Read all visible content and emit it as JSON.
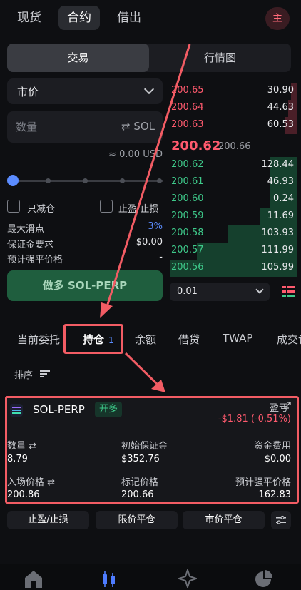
{
  "top_tabs": [
    {
      "label": "现货",
      "active": false
    },
    {
      "label": "合约",
      "active": true
    },
    {
      "label": "借出",
      "active": false
    }
  ],
  "avatar": "主",
  "segment": {
    "trade": "交易",
    "market": "行情图"
  },
  "order_form": {
    "order_type": "市价",
    "quantity_placeholder": "数量",
    "unit": "⇄ SOL",
    "usd_value": "≈ 0.00 USD",
    "reduce_only": "只减仓",
    "tp_sl": "止盈/止损",
    "slippage_label": "最大滑点",
    "slippage_value": "3%",
    "margin_label": "保证金要求",
    "margin_value": "$0.00",
    "liq_label": "预计强平价格",
    "liq_value": "-",
    "long_button": "做多 SOL-PERP"
  },
  "order_book": {
    "asks": [
      {
        "price": "200.65",
        "size": "30.90"
      },
      {
        "price": "200.64",
        "size": "44.63"
      },
      {
        "price": "200.63",
        "size": "60.53"
      }
    ],
    "mid_price": "200.62",
    "mark_price": "200.66",
    "bids": [
      {
        "price": "200.62",
        "size": "128.44"
      },
      {
        "price": "200.61",
        "size": "46.93"
      },
      {
        "price": "200.60",
        "size": "0.24"
      },
      {
        "price": "200.59",
        "size": "11.69"
      },
      {
        "price": "200.58",
        "size": "103.93"
      },
      {
        "price": "200.57",
        "size": "111.99"
      },
      {
        "price": "200.56",
        "size": "105.99"
      }
    ],
    "tick_size": "0.01"
  },
  "position_tabs": {
    "open_orders": "当前委托",
    "positions": "持仓",
    "positions_count": "1",
    "balance": "余额",
    "borrow": "借贷",
    "twap": "TWAP",
    "fills": "成交记"
  },
  "sort_label": "排序",
  "position": {
    "symbol": "SOL-PERP",
    "side": "开多",
    "pnl_label": "盈亏",
    "pnl_value": "-$1.81 (-0.51%)",
    "qty_label": "数量 ⇄",
    "qty_value": "8.79",
    "init_margin_label": "初始保证金",
    "init_margin_value": "$352.76",
    "funding_label": "资金费用",
    "funding_value": "$0.00",
    "entry_label": "入场价格 ⇄",
    "entry_value": "200.86",
    "mark_label": "标记价格",
    "mark_value": "200.66",
    "liq_label": "预计强平价格",
    "liq_value": "162.83"
  },
  "actions": {
    "tp_sl": "止盈/止损",
    "limit_close": "限价平仓",
    "market_close": "市价平仓"
  },
  "colors": {
    "bid": "#3ec98a",
    "ask": "#ff5a6e",
    "accent": "#5b8cff",
    "annotation": "#f25c64"
  }
}
